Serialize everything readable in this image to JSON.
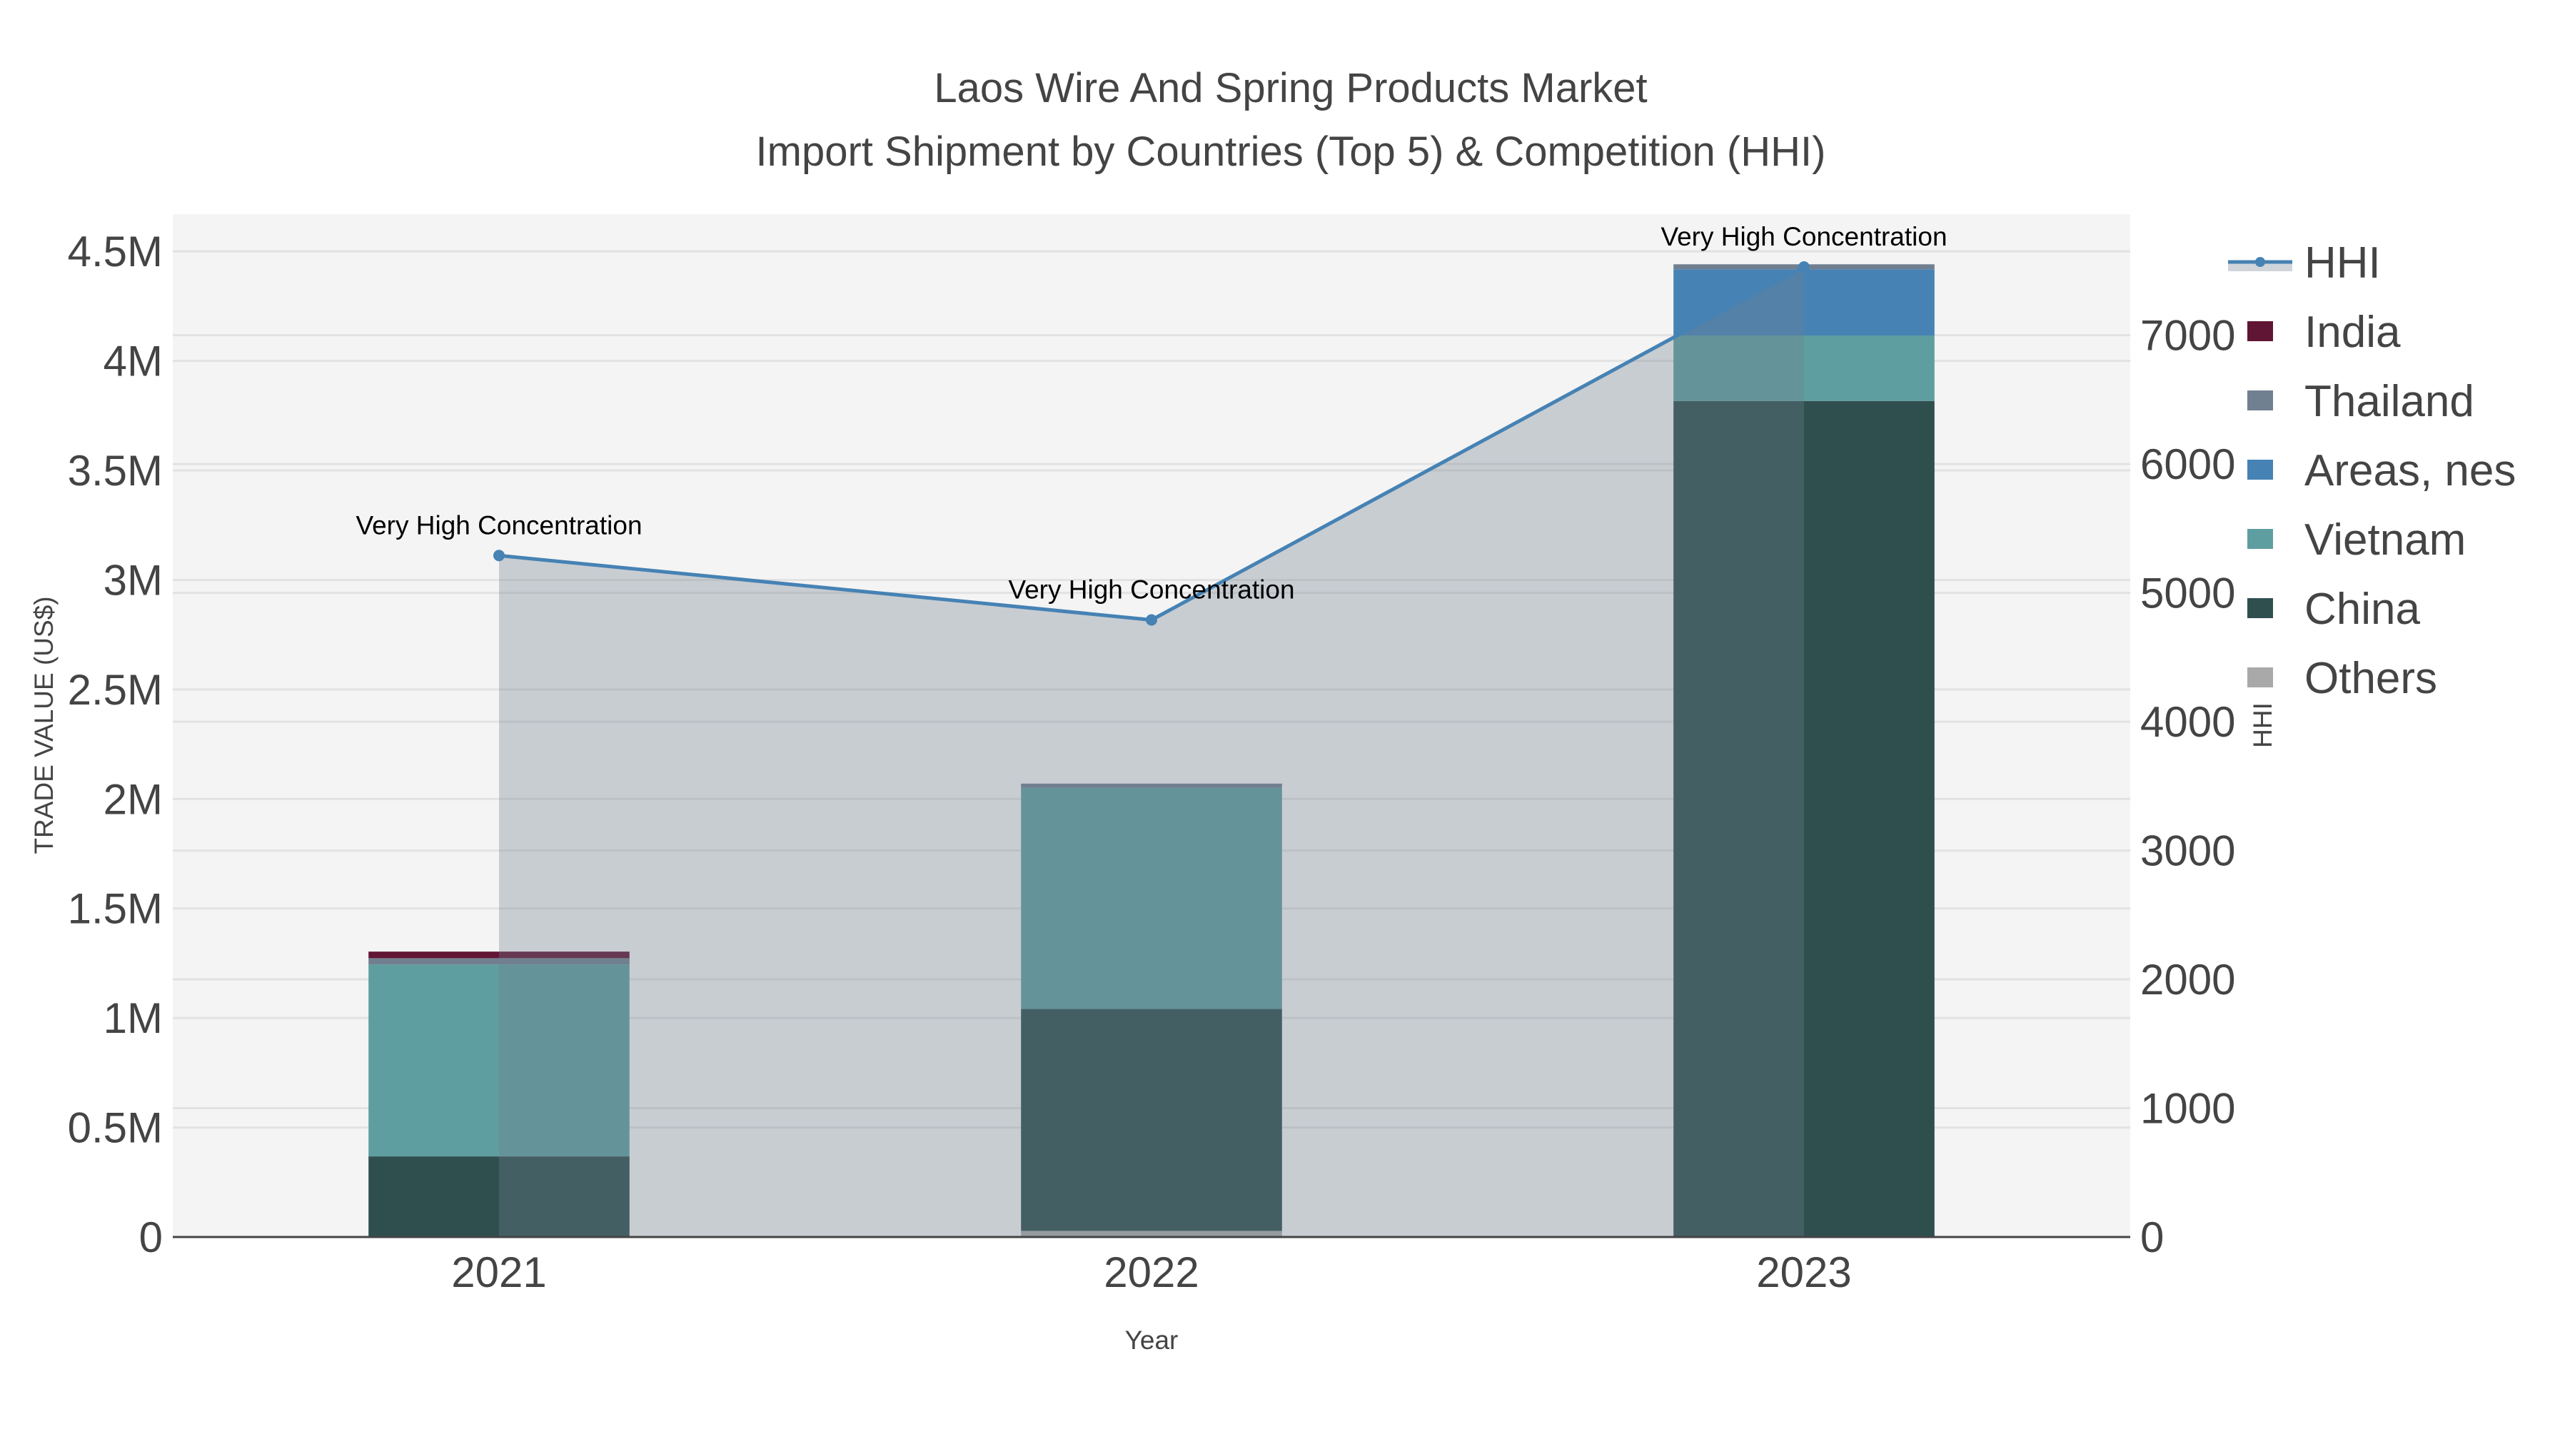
{
  "chart_data": {
    "type": "bar",
    "title": "Laos Wire And Spring Products Market",
    "subtitle": "Import Shipment by Countries (Top 5) & Competition (HHI)",
    "xlabel": "Year",
    "ylabel": "TRADE VALUE (US$)",
    "y2label": "HHI",
    "categories": [
      "2021",
      "2022",
      "2023"
    ],
    "ylim": [
      0,
      4670000
    ],
    "y2lim": [
      0,
      7940
    ],
    "yticks": [
      {
        "v": 0,
        "label": "0"
      },
      {
        "v": 500000,
        "label": "0.5M"
      },
      {
        "v": 1000000,
        "label": "1M"
      },
      {
        "v": 1500000,
        "label": "1.5M"
      },
      {
        "v": 2000000,
        "label": "2M"
      },
      {
        "v": 2500000,
        "label": "2.5M"
      },
      {
        "v": 3000000,
        "label": "3M"
      },
      {
        "v": 3500000,
        "label": "3.5M"
      },
      {
        "v": 4000000,
        "label": "4M"
      },
      {
        "v": 4500000,
        "label": "4.5M"
      }
    ],
    "y2ticks": [
      {
        "v": 0,
        "label": "0"
      },
      {
        "v": 1000,
        "label": "1000"
      },
      {
        "v": 2000,
        "label": "2000"
      },
      {
        "v": 3000,
        "label": "3000"
      },
      {
        "v": 4000,
        "label": "4000"
      },
      {
        "v": 5000,
        "label": "5000"
      },
      {
        "v": 6000,
        "label": "6000"
      },
      {
        "v": 7000,
        "label": "7000"
      }
    ],
    "grid": true,
    "legend_position": "right",
    "series": [
      {
        "name": "Others",
        "color": "#a9a9a9",
        "values": [
          0,
          28000,
          0
        ]
      },
      {
        "name": "China",
        "color": "#2f4f4f",
        "values": [
          368000,
          1013000,
          3817000
        ]
      },
      {
        "name": "Vietnam",
        "color": "#5f9ea0",
        "values": [
          876000,
          1010000,
          299000
        ]
      },
      {
        "name": "Areas, nes",
        "color": "#4682b4",
        "values": [
          0,
          0,
          302000
        ]
      },
      {
        "name": "Thailand",
        "color": "#708090",
        "values": [
          29000,
          19000,
          23000
        ]
      },
      {
        "name": "India",
        "color": "#611535",
        "values": [
          30000,
          0,
          0
        ]
      }
    ],
    "hhi": {
      "name": "HHI",
      "color": "#4682b4",
      "values": [
        5290,
        4790,
        7530
      ]
    },
    "annotations": [
      "Very High Concentration",
      "Very High Concentration",
      "Very High Concentration"
    ],
    "legend": [
      "HHI",
      "India",
      "Thailand",
      "Areas, nes",
      "Vietnam",
      "China",
      "Others"
    ]
  }
}
